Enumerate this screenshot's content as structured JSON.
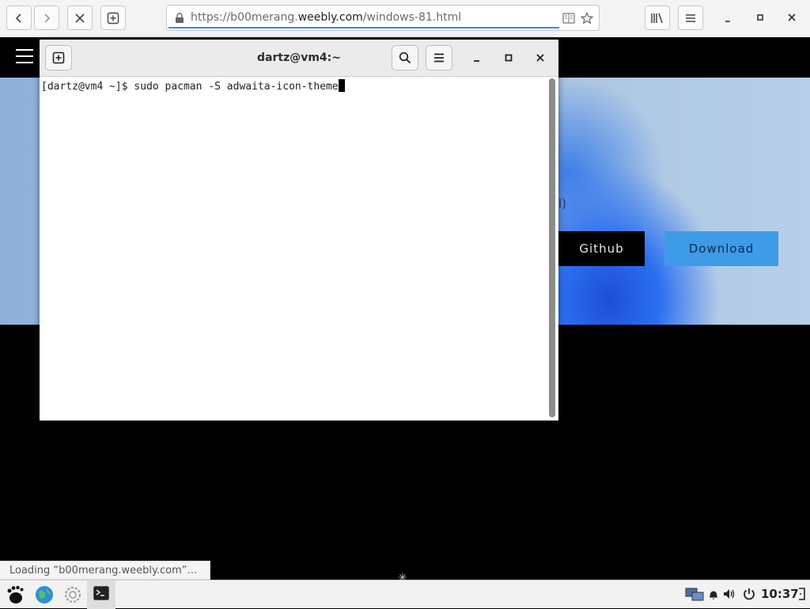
{
  "browser": {
    "url_prefix": "https://b00merang.",
    "url_host": "weebly.com",
    "url_path": "/windows-81.html"
  },
  "website": {
    "hero_fragment": "l)",
    "github_label": "Github",
    "download_label": "Download",
    "status": "Loading “b00merang.weebly.com”…"
  },
  "terminal": {
    "title": "dartz@vm4:~",
    "prompt": "[dartz@vm4 ~]$ ",
    "command": "sudo pacman -S adwaita-icon-theme"
  },
  "taskbar": {
    "clock": "10:37",
    "icons": [
      "gnome-foot-icon",
      "globe-icon",
      "settings-icon",
      "terminal-icon"
    ]
  },
  "colors": {
    "download_button": "#3e9be8",
    "hero_accent": "#1e4ed8",
    "url_underline": "#3b83f6"
  }
}
